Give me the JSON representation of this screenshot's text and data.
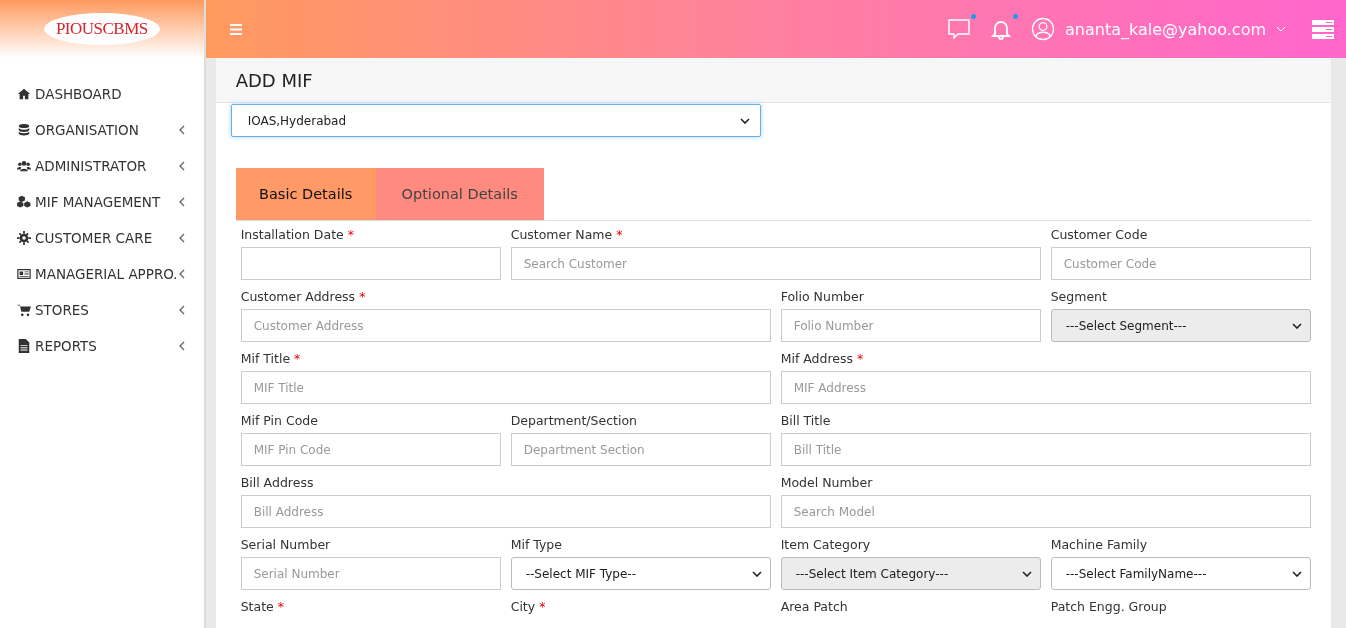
{
  "logo": "PIOUSCBMS",
  "sidebar": {
    "items": [
      {
        "label": "DASHBOARD",
        "expandable": false
      },
      {
        "label": "ORGANISATION",
        "expandable": true
      },
      {
        "label": "ADMINISTRATOR",
        "expandable": true
      },
      {
        "label": "MIF MANAGEMENT",
        "expandable": true
      },
      {
        "label": "CUSTOMER CARE",
        "expandable": true
      },
      {
        "label": "MANAGERIAL APPRO.",
        "expandable": true
      },
      {
        "label": "STORES",
        "expandable": true
      },
      {
        "label": "REPORTS",
        "expandable": true
      }
    ]
  },
  "header": {
    "notifications": [
      {
        "kind": "chat",
        "unread": true
      },
      {
        "kind": "bell",
        "unread": true
      }
    ],
    "user": "ananta_kale@yahoo.com"
  },
  "page": {
    "title": "ADD MIF",
    "branch_select": "IOAS,Hyderabad"
  },
  "tabs": [
    {
      "label": "Basic Details",
      "selected": true
    },
    {
      "label": "Optional Details",
      "selected": false
    }
  ],
  "form": {
    "rows": [
      [
        {
          "label": "Installation Date",
          "required_mark": "*",
          "kind": "input"
        },
        {
          "label": "Customer Name",
          "required_mark": "*",
          "kind": "input",
          "placeholder": "Search Customer"
        },
        {
          "label": "Customer Code",
          "kind": "input",
          "placeholder": "Customer Code"
        }
      ],
      [
        {
          "label": "Customer Address",
          "required_mark": "*",
          "kind": "input",
          "placeholder": "Customer Address"
        },
        {
          "label": "Folio Number",
          "kind": "input",
          "placeholder": "Folio Number"
        },
        {
          "label": "Segment",
          "kind": "select",
          "value": "---Select Segment---",
          "disabled": true
        }
      ],
      [
        {
          "label": "Mif Title",
          "required_mark": "*",
          "kind": "input",
          "placeholder": "MIF Title"
        },
        {
          "label": "Mif Address",
          "required_mark": "*",
          "kind": "input",
          "placeholder": "MIF Address"
        }
      ],
      [
        {
          "label": "Mif Pin Code",
          "kind": "input",
          "placeholder": "MIF Pin Code"
        },
        {
          "label": "Department/Section",
          "kind": "input",
          "placeholder": "Department Section"
        },
        {
          "label": "Bill Title",
          "kind": "input",
          "placeholder": "Bill Title"
        }
      ],
      [
        {
          "label": "Bill Address",
          "kind": "input",
          "placeholder": "Bill Address"
        },
        {
          "label": "Model Number",
          "kind": "input",
          "placeholder": "Search Model"
        }
      ],
      [
        {
          "label": "Serial Number",
          "kind": "input",
          "placeholder": "Serial Number"
        },
        {
          "label": "Mif Type",
          "kind": "select",
          "value": "--Select MIF Type--",
          "disabled": false
        },
        {
          "label": "Item Category",
          "kind": "select",
          "value": "---Select Item Category---",
          "disabled": true
        },
        {
          "label": "Machine Family",
          "kind": "select",
          "value": "---Select FamilyName---",
          "disabled": false
        }
      ],
      [
        {
          "label": "State",
          "required_mark": "*",
          "kind": "label"
        },
        {
          "label": "City",
          "required_mark": "*",
          "kind": "label"
        },
        {
          "label": "Area Patch",
          "kind": "label"
        },
        {
          "label": "Patch Engg. Group",
          "kind": "label"
        }
      ]
    ]
  }
}
